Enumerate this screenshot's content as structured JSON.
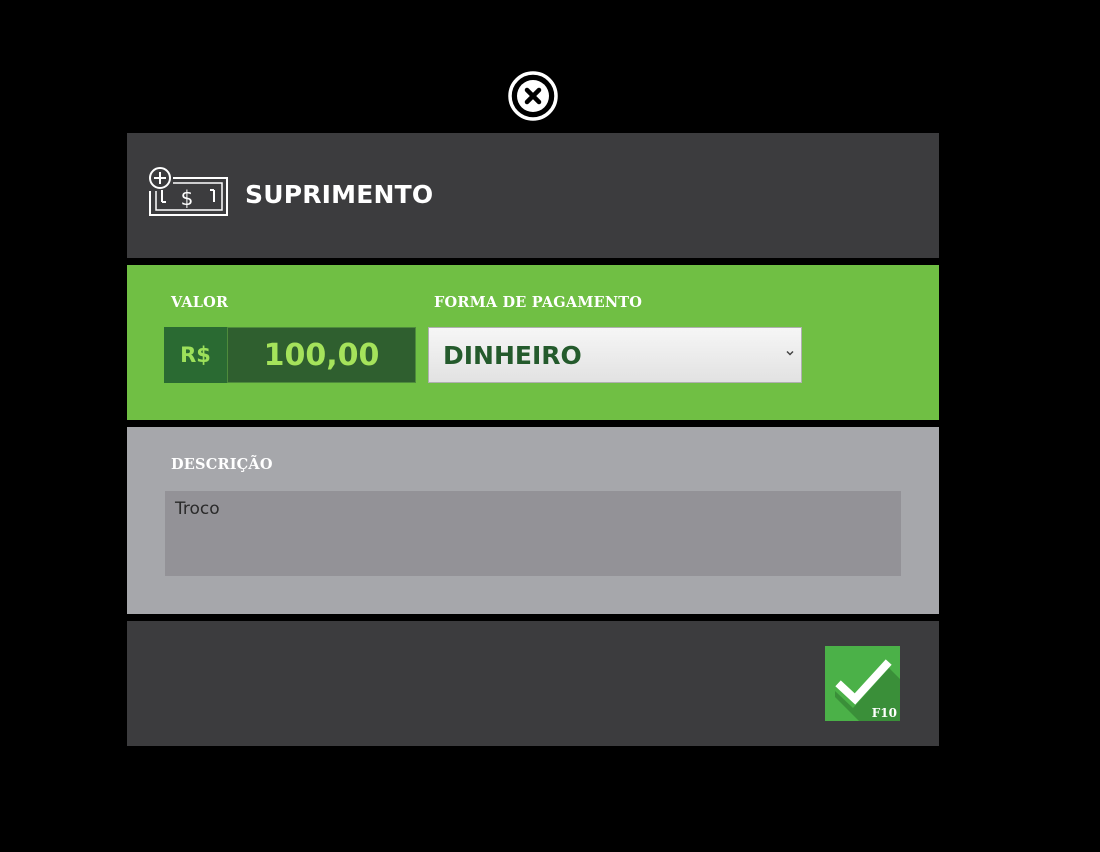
{
  "dialog": {
    "title": "SUPRIMENTO",
    "close_icon": "close-circle-icon",
    "header_icon": "cash-add-icon"
  },
  "valor": {
    "label": "VALOR",
    "currency": "R$",
    "amount": "100,00"
  },
  "payment": {
    "label": "FORMA DE PAGAMENTO",
    "selected": "DINHEIRO"
  },
  "description": {
    "label": "DESCRIÇÃO",
    "value": "Troco"
  },
  "confirm": {
    "icon": "checkmark-icon",
    "shortcut": "F10"
  },
  "colors": {
    "background": "#000000",
    "panel_dark": "#3c3c3e",
    "panel_green": "#70bf44",
    "panel_gray": "#a6a7ab",
    "textarea_gray": "#939297",
    "confirm_green": "#4bb148"
  }
}
